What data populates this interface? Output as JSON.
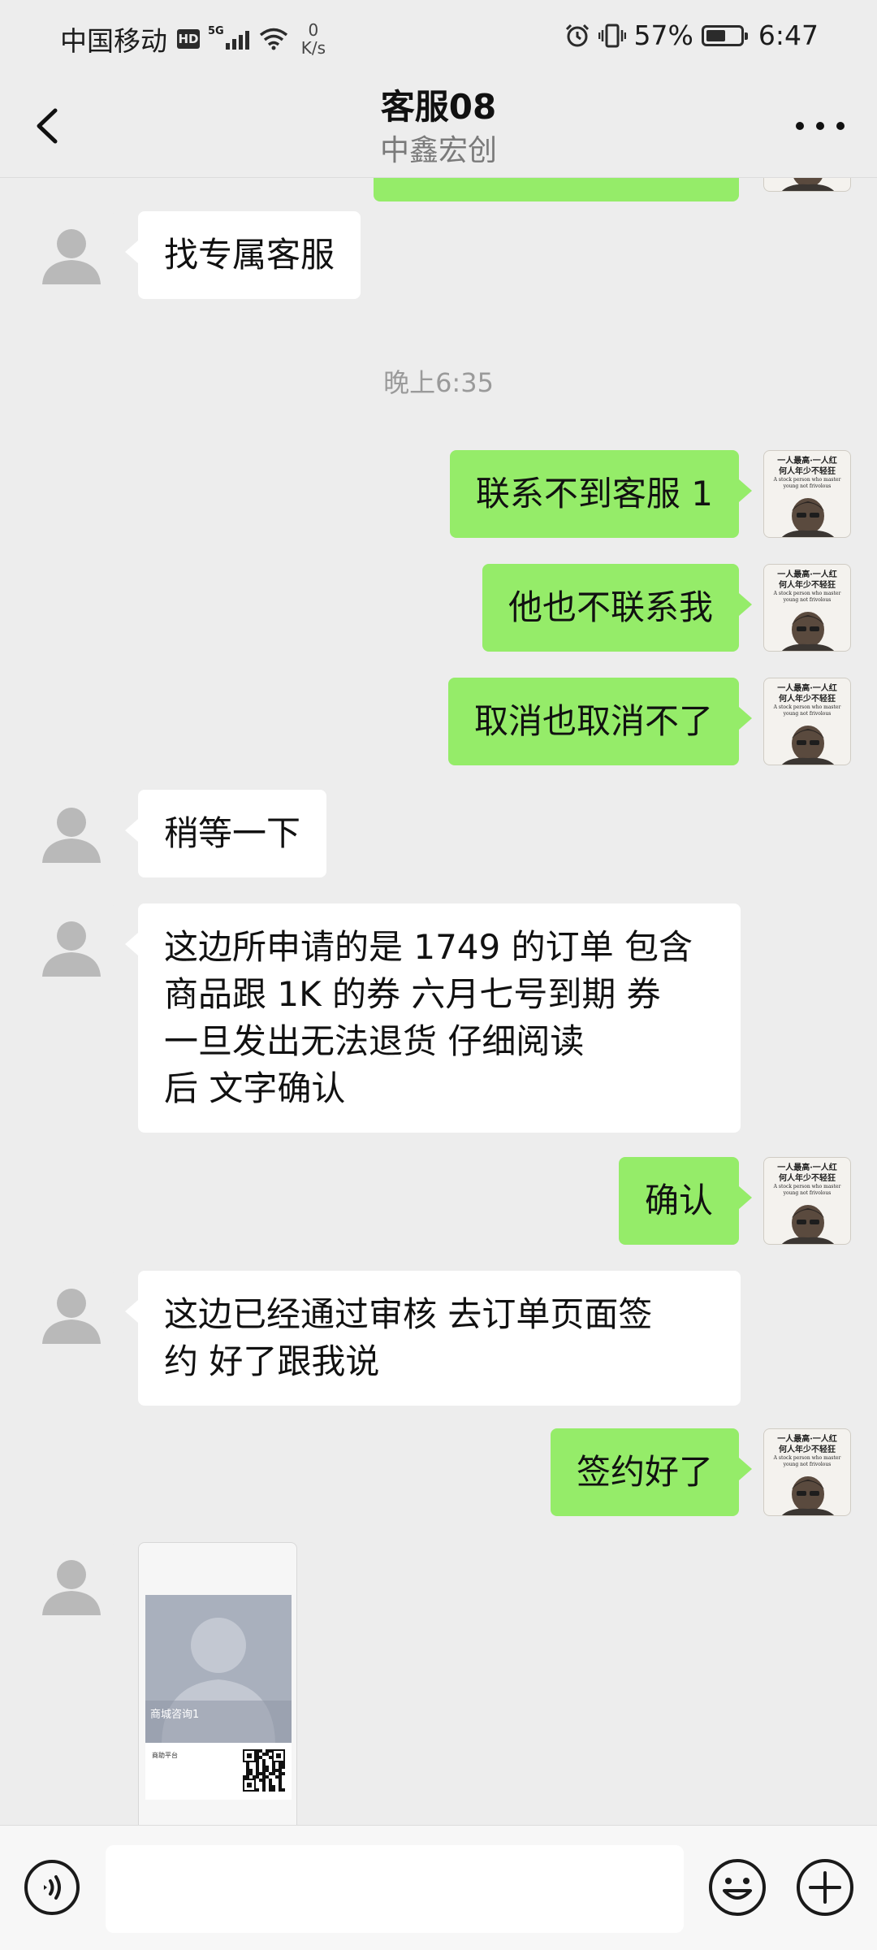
{
  "status_bar": {
    "carrier": "中国移动",
    "hd": "HD",
    "network": "5G",
    "speed_value": "0",
    "speed_unit": "K/s",
    "battery_percent": "57%",
    "battery_level": 0.57,
    "time": "6:47"
  },
  "header": {
    "title": "客服08",
    "subtitle": "中鑫宏创"
  },
  "messages": [
    {
      "side": "in",
      "text": "找专属客服"
    },
    {
      "type": "timestamp",
      "text": "晚上6:35"
    },
    {
      "side": "out",
      "text": "联系不到客服 1"
    },
    {
      "side": "out",
      "text": "他也不联系我"
    },
    {
      "side": "out",
      "text": "取消也取消不了"
    },
    {
      "side": "in",
      "text": "稍等一下"
    },
    {
      "side": "in",
      "lines": [
        "这边所申请的是 1749 的订单 包含",
        "商品跟 1K 的券  六月七号到期  券",
        "一旦发出无法退货     仔细阅读",
        "后   文字确认"
      ]
    },
    {
      "side": "out",
      "text": "确认"
    },
    {
      "side": "in",
      "lines": [
        "这边已经通过审核  去订单页面签",
        "约   好了跟我说"
      ]
    },
    {
      "side": "out",
      "text": "签约好了"
    },
    {
      "side": "in",
      "type": "card",
      "name": "商城咨询1",
      "sub": "商助平台"
    }
  ],
  "my_avatar_caption": {
    "line1": "一人最高·一人红",
    "line2": "何人年少不轻狂",
    "line3": "A stock person who master",
    "line4": "young not frivolous"
  },
  "input": {
    "value": "",
    "placeholder": ""
  },
  "colors": {
    "background": "#ededed",
    "outgoing_bubble": "#95ec69",
    "incoming_bubble": "#ffffff",
    "timestamp": "#9a9a9a"
  },
  "icons": [
    "back-arrow-icon",
    "more-icon",
    "voice-icon",
    "emoji-icon",
    "plus-icon",
    "default-avatar-icon",
    "qr-code-icon"
  ]
}
